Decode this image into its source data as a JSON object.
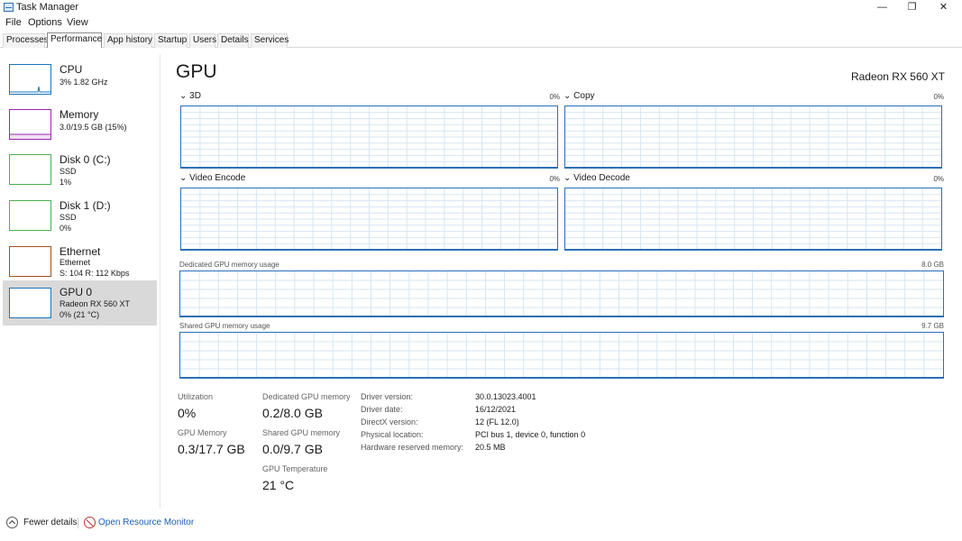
{
  "window": {
    "title": "Task Manager",
    "minimize_glyph": "—",
    "maximize_glyph": "❐",
    "close_glyph": "✕"
  },
  "menu": [
    "File",
    "Options",
    "View"
  ],
  "tabs": [
    "Processes",
    "Performance",
    "App history",
    "Startup",
    "Users",
    "Details",
    "Services"
  ],
  "active_tab": "Performance",
  "sidebar": [
    {
      "name": "CPU",
      "line1": "3%  1.82 GHz",
      "line2": "",
      "color": "#1a75bc"
    },
    {
      "name": "Memory",
      "line1": "3.0/19.5 GB (15%)",
      "line2": "",
      "color": "#9b27af"
    },
    {
      "name": "Disk 0 (C:)",
      "line1": "SSD",
      "line2": "1%",
      "color": "#4caf50"
    },
    {
      "name": "Disk 1 (D:)",
      "line1": "SSD",
      "line2": "0%",
      "color": "#4caf50"
    },
    {
      "name": "Ethernet",
      "line1": "Ethernet",
      "line2": "S: 104  R: 112 Kbps",
      "color": "#a0521d"
    },
    {
      "name": "GPU 0",
      "line1": "Radeon RX 560 XT",
      "line2": "0%  (21 °C)",
      "color": "#1a75bc"
    }
  ],
  "selected_item": "GPU 0",
  "main": {
    "title": "GPU",
    "model": "Radeon RX 560 XT",
    "graphs": [
      {
        "label": "3D",
        "pct": "0%"
      },
      {
        "label": "Copy",
        "pct": "0%"
      },
      {
        "label": "Video Encode",
        "pct": "0%"
      },
      {
        "label": "Video Decode",
        "pct": "0%"
      }
    ],
    "dedicated": {
      "label": "Dedicated GPU memory usage",
      "max": "8.0 GB"
    },
    "shared": {
      "label": "Shared GPU memory usage",
      "max": "9.7 GB"
    },
    "graph_color": "#2a6fb5"
  },
  "stats": {
    "utilization_label": "Utilization",
    "utilization_value": "0%",
    "dedicated_label": "Dedicated GPU memory",
    "dedicated_value": "0.2/8.0 GB",
    "gpu_memory_label": "GPU Memory",
    "gpu_memory_value": "0.3/17.7 GB",
    "shared_label": "Shared GPU memory",
    "shared_value": "0.0/9.7 GB",
    "temp_label": "GPU Temperature",
    "temp_value": "21 °C"
  },
  "info": [
    {
      "label": "Driver version:",
      "value": "30.0.13023.4001"
    },
    {
      "label": "Driver date:",
      "value": "16/12/2021"
    },
    {
      "label": "DirectX version:",
      "value": "12 (FL 12.0)"
    },
    {
      "label": "Physical location:",
      "value": "PCI bus 1, device 0, function 0"
    },
    {
      "label": "Hardware reserved memory:",
      "value": "20.5 MB"
    }
  ],
  "footer": {
    "fewer_details": "Fewer details",
    "resource_monitor": "Open Resource Monitor"
  }
}
